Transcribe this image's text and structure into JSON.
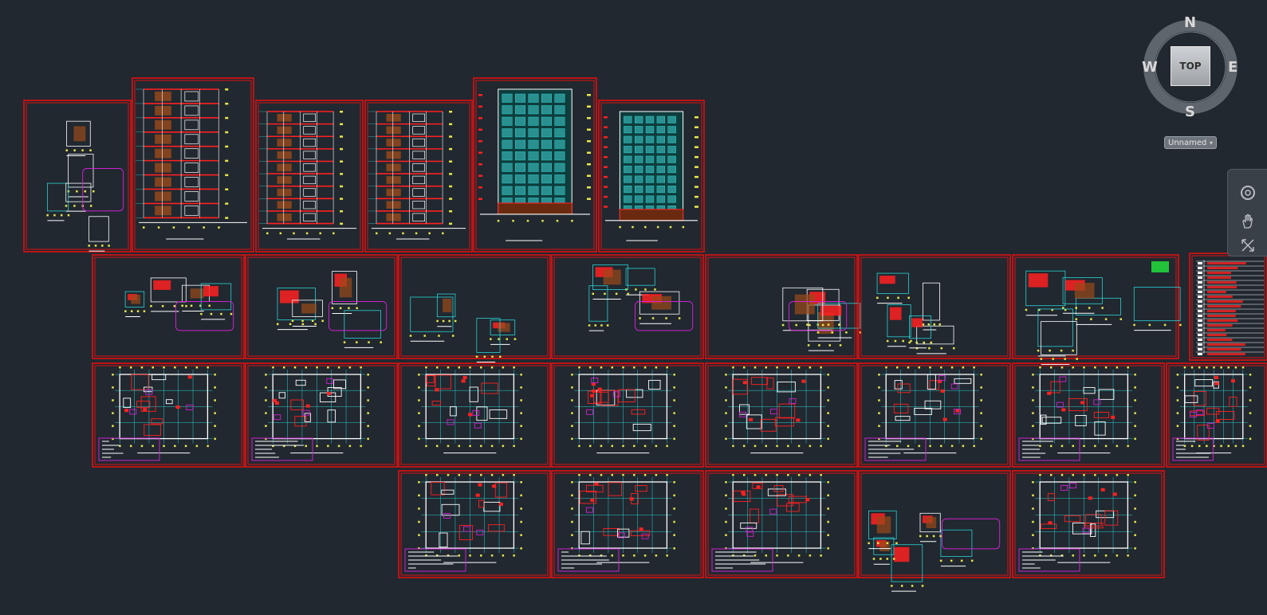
{
  "app": {
    "name": "AutoCAD drawing model space"
  },
  "viewcube": {
    "north": "N",
    "south": "S",
    "west": "W",
    "east": "E",
    "face": "TOP"
  },
  "ucs": {
    "label": "Unnamed",
    "icon": "chevron-down-icon"
  },
  "navigation_bar": {
    "tools": [
      "steering-wheel-icon",
      "pan-hand-icon",
      "zoom-extents-icon"
    ]
  },
  "colors": {
    "background": "#212830",
    "sheet_frame": "#e01010",
    "wall": "#ff2020",
    "dimension": "#e8e84a",
    "grid": "#2ad2d2",
    "annotation": "#ffffff",
    "highlight": "#d020d0",
    "hatch": "#9b4a1a",
    "label": "#22c33a"
  },
  "sheets": {
    "row1": [
      "sections-details",
      "section-a",
      "section-b",
      "section-c",
      "front-elevation",
      "side-elevation"
    ],
    "row2": [
      "detail-1",
      "detail-2",
      "detail-3",
      "detail-4",
      "detail-5",
      "detail-6",
      "detail-7",
      "schedule"
    ],
    "row3": [
      "foundation-plan",
      "roof-plan",
      "plan-1",
      "plan-2",
      "plan-3",
      "plan-4",
      "plan-5",
      "plan-6"
    ],
    "row4": [
      "plan-7",
      "plan-8",
      "plan-9",
      "stair-detail",
      "plan-10"
    ]
  }
}
